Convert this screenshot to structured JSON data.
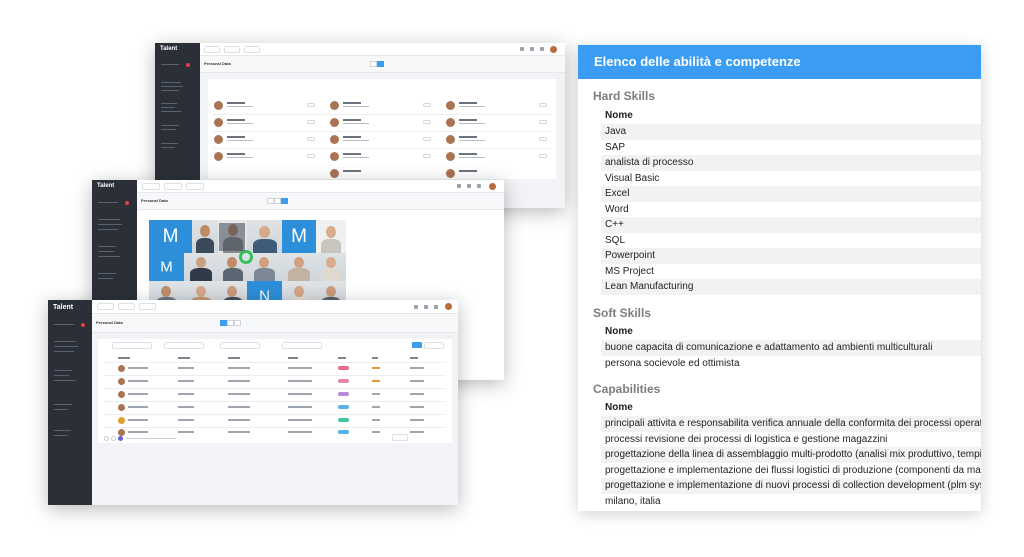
{
  "app": {
    "logo": "Talent",
    "personal_data_title": "Personal Data",
    "mosaic_letters": [
      "M",
      "M",
      "M",
      "N"
    ]
  },
  "skills": {
    "title": "Elenco delle abilità e competenze",
    "sections": [
      {
        "title": "Hard Skills",
        "column": "Nome",
        "items": [
          "Java",
          "SAP",
          "analista di processo",
          "Visual Basic",
          "Excel",
          "Word",
          "C++",
          "SQL",
          "Powerpoint",
          "MS Project",
          "Lean Manufacturing"
        ]
      },
      {
        "title": "Soft Skills",
        "column": "Nome",
        "items": [
          "buone capacita di comunicazione e adattamento ad ambienti multiculturali",
          "persona socievole ed ottimista"
        ]
      },
      {
        "title": "Capabilities",
        "column": "Nome",
        "items": [
          "principali attivita e responsabilita verifica annuale della conformita dei processi operativi",
          "processi revisione dei processi di logistica e gestione magazzini",
          "progettazione della linea di assemblaggio multi-prodotto (analisi mix produttivo, tempi",
          "progettazione e implementazione dei flussi logistici di produzione (componenti da magazzino",
          "progettazione e implementazione di nuovi processi di collection development (plm system",
          "milano, italia"
        ]
      }
    ]
  },
  "colors": {
    "accent": "#3a9df3",
    "sidebar": "#2b3038",
    "tile_blue": "#2d8fd9"
  }
}
